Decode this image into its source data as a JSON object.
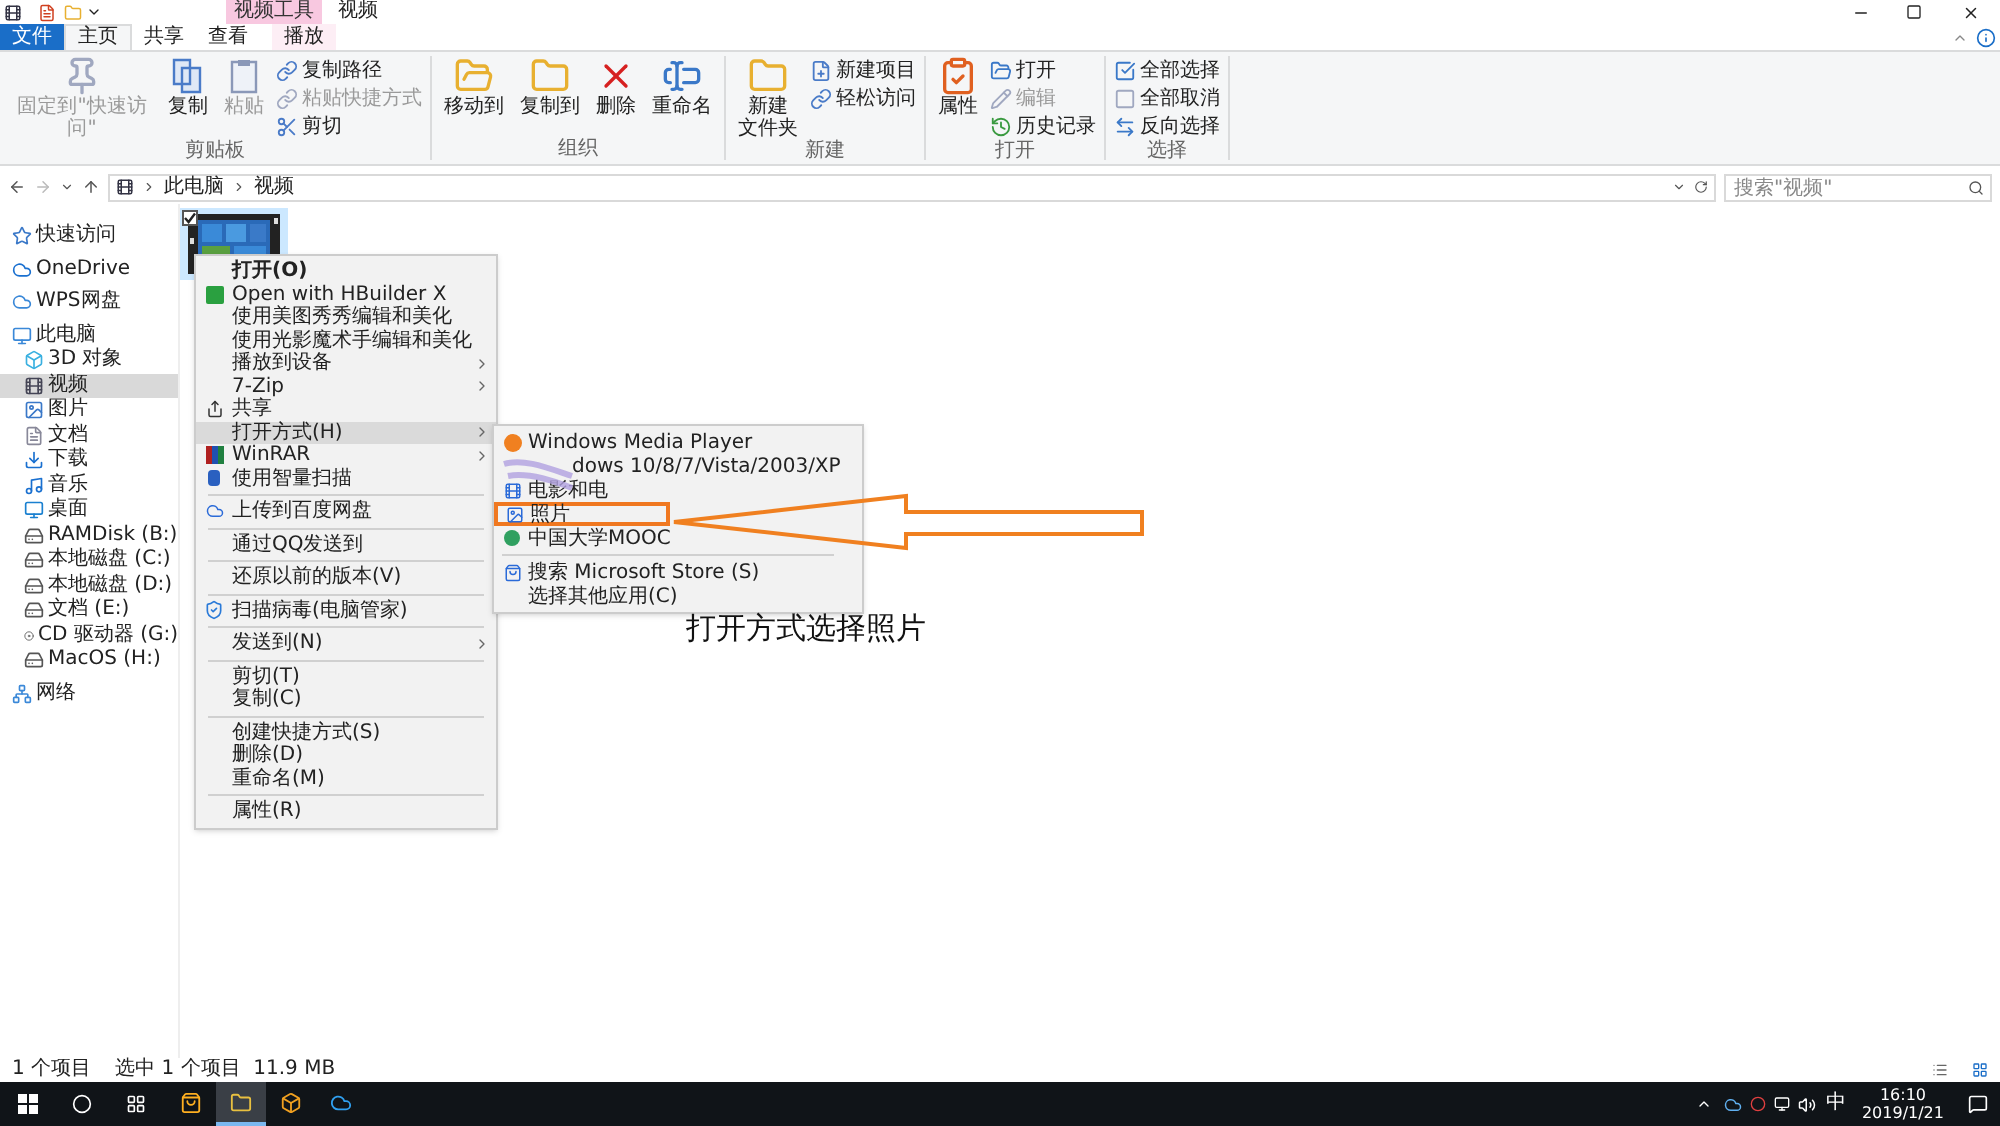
{
  "title_bar": {
    "contextual_tab": "视频工具",
    "title": "视频"
  },
  "tabs": [
    {
      "label": "文件",
      "kind": "file",
      "selected": false
    },
    {
      "label": "主页",
      "kind": "tab",
      "selected": true
    },
    {
      "label": "共享",
      "kind": "tab",
      "selected": false
    },
    {
      "label": "查看",
      "kind": "tab",
      "selected": false
    },
    {
      "label": "播放",
      "kind": "tab",
      "selected": false
    }
  ],
  "ribbon": [
    {
      "label": "剪贴板",
      "items": [
        {
          "kind": "large",
          "label": "固定到\"快速访问\"",
          "disabled": true
        },
        {
          "kind": "large",
          "label": "复制",
          "disabled": false
        },
        {
          "kind": "large",
          "label": "粘贴",
          "disabled": true
        },
        {
          "kind": "small",
          "label": "复制路径",
          "disabled": false
        },
        {
          "kind": "small",
          "label": "粘贴快捷方式",
          "disabled": true
        },
        {
          "kind": "small",
          "label": "剪切",
          "disabled": false
        }
      ]
    },
    {
      "label": "组织",
      "items": [
        {
          "kind": "large",
          "label": "移动到",
          "disabled": false
        },
        {
          "kind": "large",
          "label": "复制到",
          "disabled": false
        },
        {
          "kind": "large",
          "label": "删除",
          "disabled": false
        },
        {
          "kind": "large",
          "label": "重命名",
          "disabled": false
        }
      ]
    },
    {
      "label": "新建",
      "items": [
        {
          "kind": "large",
          "lines": [
            "新建",
            "文件夹"
          ],
          "disabled": false
        },
        {
          "kind": "small",
          "label": "新建项目",
          "disabled": false
        },
        {
          "kind": "small",
          "label": "轻松访问",
          "disabled": false
        }
      ]
    },
    {
      "label": "打开",
      "items": [
        {
          "kind": "large",
          "label": "属性",
          "disabled": false
        },
        {
          "kind": "small",
          "label": "打开",
          "disabled": false
        },
        {
          "kind": "small",
          "label": "编辑",
          "disabled": true
        },
        {
          "kind": "small",
          "label": "历史记录",
          "disabled": false
        }
      ]
    },
    {
      "label": "选择",
      "items": [
        {
          "kind": "small",
          "label": "全部选择",
          "disabled": false
        },
        {
          "kind": "small",
          "label": "全部取消",
          "disabled": false
        },
        {
          "kind": "small",
          "label": "反向选择",
          "disabled": false
        }
      ]
    }
  ],
  "address_bar": {
    "path": [
      "此电脑",
      "视频"
    ],
    "search": {
      "placeholder": "搜索\"视频\""
    }
  },
  "sidebar": {
    "items": [
      {
        "label": "快速访问",
        "selected": false
      },
      {
        "label": "OneDrive",
        "selected": false
      },
      {
        "label": "WPS网盘",
        "selected": false
      },
      {
        "label": "此电脑",
        "selected": false,
        "children": [
          {
            "label": "3D 对象",
            "selected": false
          },
          {
            "label": "视频",
            "selected": true
          },
          {
            "label": "图片",
            "selected": false
          },
          {
            "label": "文档",
            "selected": false
          },
          {
            "label": "下载",
            "selected": false
          },
          {
            "label": "音乐",
            "selected": false
          },
          {
            "label": "桌面",
            "selected": false
          },
          {
            "label": "RAMDisk (B:)",
            "selected": false
          },
          {
            "label": "本地磁盘 (C:)",
            "selected": false
          },
          {
            "label": "本地磁盘 (D:)",
            "selected": false
          },
          {
            "label": "文档 (E:)",
            "selected": false
          },
          {
            "label": "CD 驱动器 (G:)",
            "selected": false
          },
          {
            "label": "MacOS (H:)",
            "selected": false
          }
        ]
      },
      {
        "label": "网络",
        "selected": false
      }
    ]
  },
  "file": {
    "selected": true,
    "checked": true
  },
  "context_menu": [
    {
      "kind": "item",
      "label": "打开(O)",
      "bold": true,
      "submenu": false,
      "selected": false
    },
    {
      "kind": "item",
      "label": "Open with HBuilder X",
      "bold": false,
      "submenu": false,
      "selected": false
    },
    {
      "kind": "item",
      "label": "使用美图秀秀编辑和美化",
      "bold": false,
      "submenu": false,
      "selected": false
    },
    {
      "kind": "item",
      "label": "使用光影魔术手编辑和美化",
      "bold": false,
      "submenu": false,
      "selected": false
    },
    {
      "kind": "item",
      "label": "播放到设备",
      "bold": false,
      "submenu": true,
      "selected": false
    },
    {
      "kind": "item",
      "label": "7-Zip",
      "bold": false,
      "submenu": true,
      "selected": false
    },
    {
      "kind": "item",
      "label": "共享",
      "bold": false,
      "submenu": false,
      "selected": false
    },
    {
      "kind": "item",
      "label": "打开方式(H)",
      "bold": false,
      "submenu": true,
      "selected": true
    },
    {
      "kind": "item",
      "label": "WinRAR",
      "bold": false,
      "submenu": true,
      "selected": false
    },
    {
      "kind": "item",
      "label": "使用智量扫描",
      "bold": false,
      "submenu": false,
      "selected": false
    },
    {
      "kind": "separator"
    },
    {
      "kind": "item",
      "label": "上传到百度网盘",
      "bold": false,
      "submenu": false,
      "selected": false
    },
    {
      "kind": "separator"
    },
    {
      "kind": "item",
      "label": "通过QQ发送到",
      "bold": false,
      "submenu": false,
      "selected": false
    },
    {
      "kind": "separator"
    },
    {
      "kind": "item",
      "label": "还原以前的版本(V)",
      "bold": false,
      "submenu": false,
      "selected": false
    },
    {
      "kind": "separator"
    },
    {
      "kind": "item",
      "label": "扫描病毒(电脑管家)",
      "bold": false,
      "submenu": false,
      "selected": false
    },
    {
      "kind": "separator"
    },
    {
      "kind": "item",
      "label": "发送到(N)",
      "bold": false,
      "submenu": true,
      "selected": false
    },
    {
      "kind": "separator"
    },
    {
      "kind": "item",
      "label": "剪切(T)",
      "bold": false,
      "submenu": false,
      "selected": false
    },
    {
      "kind": "item",
      "label": "复制(C)",
      "bold": false,
      "submenu": false,
      "selected": false
    },
    {
      "kind": "separator"
    },
    {
      "kind": "item",
      "label": "创建快捷方式(S)",
      "bold": false,
      "submenu": false,
      "selected": false
    },
    {
      "kind": "item",
      "label": "删除(D)",
      "bold": false,
      "submenu": false,
      "selected": false
    },
    {
      "kind": "item",
      "label": "重命名(M)",
      "bold": false,
      "submenu": false,
      "selected": false
    },
    {
      "kind": "separator"
    },
    {
      "kind": "item",
      "label": "属性(R)",
      "bold": false,
      "submenu": false,
      "selected": false
    }
  ],
  "open_with_menu": [
    {
      "kind": "item",
      "label": "Windows Media Player",
      "highlighted": false
    },
    {
      "kind": "item",
      "label": "dows 10/8/7/Vista/2003/XP",
      "highlighted": false
    },
    {
      "kind": "item",
      "label": "电影和电",
      "highlighted": false
    },
    {
      "kind": "item",
      "label": "照片",
      "highlighted": true
    },
    {
      "kind": "item",
      "label": "中国大学MOOC",
      "highlighted": false
    },
    {
      "kind": "separator"
    },
    {
      "kind": "item",
      "label": "搜索 Microsoft Store (S)",
      "highlighted": false
    },
    {
      "kind": "item",
      "label": "选择其他应用(C)",
      "highlighted": false
    }
  ],
  "annotation": {
    "caption": "打开方式选择照片"
  },
  "status_bar": {
    "items": [
      "1 个项目",
      "选中 1 个项目  11.9 MB"
    ]
  },
  "taskbar": {
    "apps": [
      {
        "selected": false
      },
      {
        "selected": true
      },
      {
        "selected": false
      },
      {
        "selected": false
      }
    ],
    "input_method": "中",
    "time": "16:10",
    "date": "2019/1/21"
  }
}
